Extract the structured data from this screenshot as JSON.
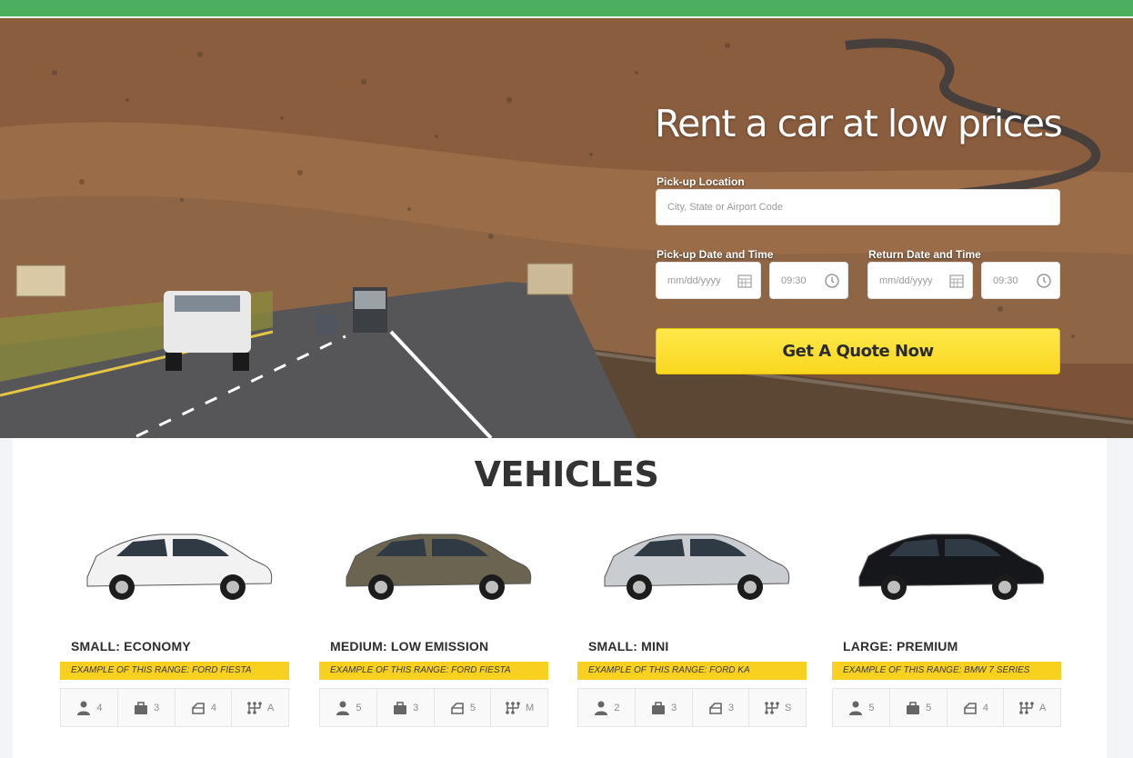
{
  "hero": {
    "title": "Rent a car at low prices",
    "pickup_location_label": "Pick-up Location",
    "pickup_location_placeholder": "City, State or Airport Code",
    "pickup_datetime_label": "Pick-up Date and Time",
    "return_datetime_label": "Return Date and Time",
    "date_placeholder": "mm/dd/yyyy",
    "pickup_time": "09:30",
    "return_time": "09:30",
    "quote_button": "Get A Quote Now"
  },
  "colors": {
    "topbar": "#4caf5f",
    "accent_yellow": "#f8d020",
    "button_yellow": "#ffe84a"
  },
  "vehicles": {
    "title": "VEHICLES",
    "cards": [
      {
        "name": "SMALL: ECONOMY",
        "range": "EXAMPLE OF THIS RANGE: FORD FIESTA",
        "seats": "4",
        "bags": "3",
        "doors": "4",
        "gearbox": "A",
        "car_color": "#f2f2f2"
      },
      {
        "name": "MEDIUM: LOW EMISSION",
        "range": "EXAMPLE OF THIS RANGE: FORD FIESTA",
        "seats": "5",
        "bags": "3",
        "doors": "5",
        "gearbox": "M",
        "car_color": "#6b6450"
      },
      {
        "name": "SMALL: MINI",
        "range": "EXAMPLE OF THIS RANGE: FORD KA",
        "seats": "2",
        "bags": "3",
        "doors": "3",
        "gearbox": "S",
        "car_color": "#c9cdd2"
      },
      {
        "name": "LARGE: PREMIUM",
        "range": "EXAMPLE OF THIS RANGE: BMW 7 SERIES",
        "seats": "5",
        "bags": "5",
        "doors": "4",
        "gearbox": "A",
        "car_color": "#15171a"
      }
    ]
  }
}
